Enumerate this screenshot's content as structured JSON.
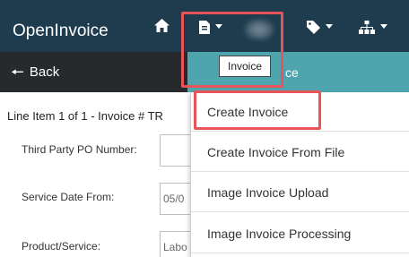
{
  "navbar": {
    "brand": "OpenInvoice",
    "icons": [
      "home-icon",
      "invoice-icon",
      "tag-icon",
      "sitemap-icon"
    ]
  },
  "subbar": {
    "back_label": "Back",
    "teal_text": "ce"
  },
  "tooltip": "Invoice",
  "form": {
    "line_title": "Line Item 1 of 1 - Invoice # TR",
    "fields": [
      {
        "label": "Third Party PO Number:",
        "value": ""
      },
      {
        "label": "Service Date From:",
        "value": "05/0"
      },
      {
        "label": "Product/Service:",
        "value": "Labo"
      }
    ]
  },
  "dropdown": {
    "items": [
      "Create Invoice",
      "Create Invoice From File",
      "Image Invoice Upload",
      "Image Invoice Processing"
    ]
  },
  "colors": {
    "navbar": "#1f3c4f",
    "subbar": "#262a2d",
    "teal": "#4ea5ad",
    "highlight": "#e8545a"
  }
}
